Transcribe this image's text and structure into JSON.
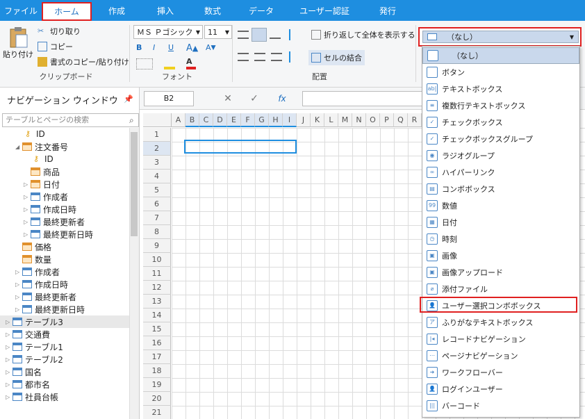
{
  "menubar": {
    "tabs": [
      "ファイル",
      "ホーム",
      "作成",
      "挿入",
      "数式",
      "データ",
      "ユーザー認証",
      "発行"
    ],
    "active": "ホーム"
  },
  "ribbon": {
    "clipboard": {
      "paste": "貼り付け",
      "cut": "切り取り",
      "copy": "コピー",
      "format_copy": "書式のコピー/貼り付け",
      "label": "クリップボード"
    },
    "font": {
      "name": "ＭＳ Ｐゴシック",
      "size": "11",
      "bold": "B",
      "italic": "I",
      "underline": "U",
      "label": "フォント"
    },
    "align": {
      "wrap": "折り返して全体を表示する",
      "merge": "セルの結合",
      "label": "配置"
    }
  },
  "nav": {
    "title": "ナビゲーション ウィンドウ",
    "search_placeholder": "テーブルとページの検索",
    "items": [
      {
        "text": "ID",
        "indent": 36,
        "kind": "key"
      },
      {
        "text": "注文番号",
        "indent": 22,
        "kind": "table-o",
        "arrow": "◢"
      },
      {
        "text": "ID",
        "indent": 48,
        "kind": "key"
      },
      {
        "text": "商品",
        "indent": 44,
        "kind": "table-o"
      },
      {
        "text": "日付",
        "indent": 34,
        "kind": "table-o",
        "arrow": "▷"
      },
      {
        "text": "作成者",
        "indent": 34,
        "kind": "table",
        "arrow": "▷"
      },
      {
        "text": "作成日時",
        "indent": 34,
        "kind": "table",
        "arrow": "▷"
      },
      {
        "text": "最終更新者",
        "indent": 34,
        "kind": "table",
        "arrow": "▷"
      },
      {
        "text": "最終更新日時",
        "indent": 34,
        "kind": "table",
        "arrow": "▷"
      },
      {
        "text": "価格",
        "indent": 32,
        "kind": "table-o"
      },
      {
        "text": "数量",
        "indent": 32,
        "kind": "table-o"
      },
      {
        "text": "作成者",
        "indent": 22,
        "kind": "table",
        "arrow": "▷"
      },
      {
        "text": "作成日時",
        "indent": 22,
        "kind": "table",
        "arrow": "▷"
      },
      {
        "text": "最終更新者",
        "indent": 22,
        "kind": "table",
        "arrow": "▷"
      },
      {
        "text": "最終更新日時",
        "indent": 22,
        "kind": "table",
        "arrow": "▷"
      },
      {
        "text": "テーブル3",
        "indent": 8,
        "kind": "table",
        "arrow": "▷",
        "sel": true
      },
      {
        "text": "交通費",
        "indent": 8,
        "kind": "table",
        "arrow": "▷"
      },
      {
        "text": "テーブル1",
        "indent": 8,
        "kind": "table",
        "arrow": "▷"
      },
      {
        "text": "テーブル2",
        "indent": 8,
        "kind": "table",
        "arrow": "▷"
      },
      {
        "text": "国名",
        "indent": 8,
        "kind": "table",
        "arrow": "▷"
      },
      {
        "text": "都市名",
        "indent": 8,
        "kind": "table",
        "arrow": "▷"
      },
      {
        "text": "社員台帳",
        "indent": 8,
        "kind": "table",
        "arrow": "▷"
      }
    ]
  },
  "formula": {
    "cell": "B2",
    "cancel": "✕",
    "confirm": "✓",
    "fx": "fx"
  },
  "sheet": {
    "columns": [
      "A",
      "B",
      "C",
      "D",
      "E",
      "F",
      "G",
      "H",
      "I",
      "J",
      "K",
      "L",
      "M",
      "N",
      "O",
      "P",
      "Q",
      "R",
      "S"
    ],
    "rows": [
      "1",
      "2",
      "3",
      "4",
      "5",
      "6",
      "7",
      "8",
      "9",
      "10",
      "11",
      "12",
      "13",
      "14",
      "15",
      "16",
      "17",
      "18",
      "19",
      "20",
      "21"
    ]
  },
  "dropdown": {
    "selected": "（なし）"
  },
  "menu_items": [
    {
      "label": "（なし）",
      "icon": "none",
      "sel": true
    },
    {
      "label": "ボタン",
      "icon": "button"
    },
    {
      "label": "テキストボックス",
      "icon": "ab"
    },
    {
      "label": "複数行テキストボックス",
      "icon": "multi"
    },
    {
      "label": "チェックボックス",
      "icon": "check"
    },
    {
      "label": "チェックボックスグループ",
      "icon": "check"
    },
    {
      "label": "ラジオグループ",
      "icon": "radio"
    },
    {
      "label": "ハイパーリンク",
      "icon": "link"
    },
    {
      "label": "コンボボックス",
      "icon": "combo"
    },
    {
      "label": "数値",
      "icon": "num"
    },
    {
      "label": "日付",
      "icon": "date"
    },
    {
      "label": "時刻",
      "icon": "clock"
    },
    {
      "label": "画像",
      "icon": "img"
    },
    {
      "label": "画像アップロード",
      "icon": "img"
    },
    {
      "label": "添付ファイル",
      "icon": "clip"
    },
    {
      "label": "ユーザー選択コンボボックス",
      "icon": "user"
    },
    {
      "label": "ふりがなテキストボックス",
      "icon": "furi"
    },
    {
      "label": "レコードナビゲーション",
      "icon": "nav"
    },
    {
      "label": "ページナビゲーション",
      "icon": "pnav"
    },
    {
      "label": "ワークフローバー",
      "icon": "flow"
    },
    {
      "label": "ログインユーザー",
      "icon": "user"
    },
    {
      "label": "バーコード",
      "icon": "bar"
    }
  ]
}
